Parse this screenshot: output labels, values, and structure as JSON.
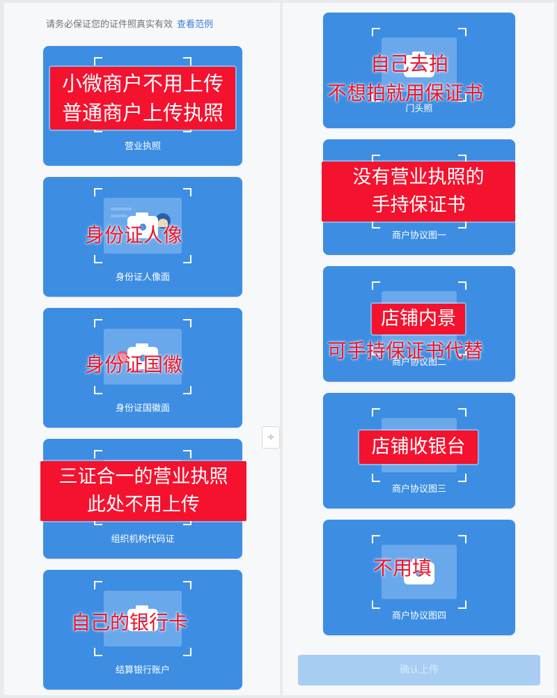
{
  "notice": {
    "text": "请务必保证您的证件照真实有效",
    "link": "查看范例"
  },
  "left_cards": [
    {
      "label": "营业执照"
    },
    {
      "label": "身份证人像面"
    },
    {
      "label": "身份证国徽面"
    },
    {
      "label": "组织机构代码证"
    },
    {
      "label": "结算银行账户"
    }
  ],
  "right_cards": [
    {
      "label": "门头照"
    },
    {
      "label": "商户协议图一"
    },
    {
      "label": "商户协议图二"
    },
    {
      "label": "商户协议图三"
    },
    {
      "label": "商户协议图四"
    }
  ],
  "annotations": {
    "business_license": [
      "小微商户不用上传",
      "普通商户上传执照"
    ],
    "id_portrait": "身份证人像",
    "id_emblem": "身份证国徽",
    "three_in_one": [
      "三证合一的营业执照",
      "此处不用上传"
    ],
    "bank_card": "自己的银行卡",
    "storefront_1": "自己去拍",
    "storefront_2": "不想拍就用保证书",
    "no_license": [
      "没有营业执照的",
      "手持保证书"
    ],
    "interior_box": "店铺内景",
    "interior_text": "可手持保证书代替",
    "cashier": "店铺收银台",
    "no_fill": "不用填"
  },
  "divider": {
    "symbol": "÷"
  },
  "confirm_button": {
    "label": "确认上传"
  },
  "colors": {
    "card_blue": "#3d8ee2",
    "overlay_red": "#f4122e",
    "annotation_red": "#e8142c",
    "link_blue": "#3d7ad6",
    "button_disabled": "#a7cdf3"
  }
}
